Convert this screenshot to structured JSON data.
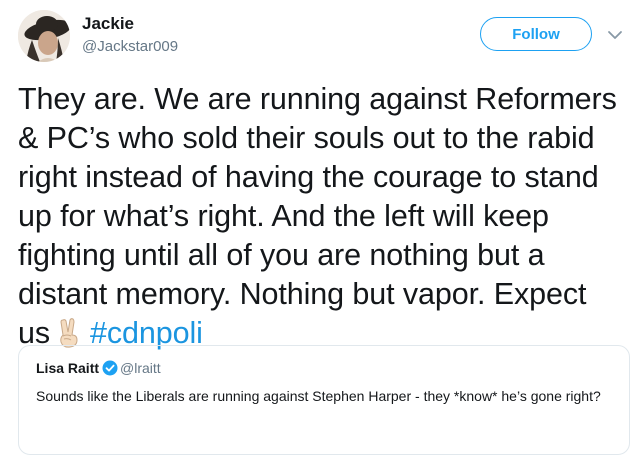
{
  "tweet": {
    "author": {
      "name": "Jackie",
      "handle": "@Jackstar009",
      "avatar_icon": "profile-photo-icon"
    },
    "follow_label": "Follow",
    "menu_icon": "chevron-down-icon",
    "lines": [
      "They are. We are running against Reformers",
      "& PC’s who sold their souls out to the rabid",
      "right instead of having the courage to stand",
      "up for what’s right. And the left will keep",
      "fighting until all of you are nothing but a",
      "distant memory. Nothing but vapor. Expect"
    ],
    "last_line_text": "us",
    "emoji_icon": "victory-hand-emoji-icon",
    "hashtag": "#cdnpoli"
  },
  "quoted_tweet": {
    "author_name": "Lisa Raitt",
    "verified_icon": "verified-badge-icon",
    "handle": "@lraitt",
    "text": "Sounds like the Liberals are running against Stephen Harper - they *know* he’s gone right?"
  },
  "colors": {
    "link_blue": "#1b95e0",
    "follow_blue": "#1da1f2",
    "text_primary": "#14171a",
    "text_secondary": "#657786",
    "border": "#e1e8ed"
  }
}
